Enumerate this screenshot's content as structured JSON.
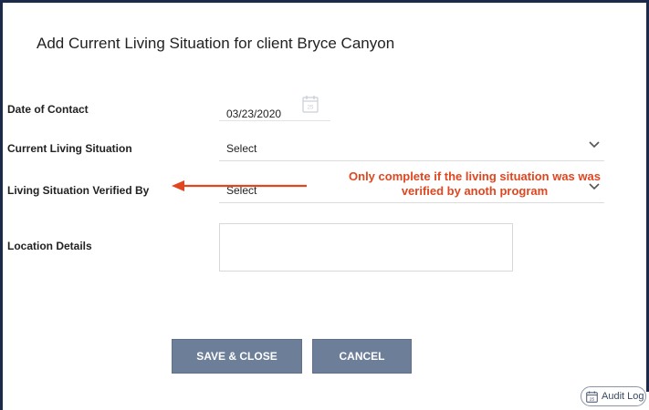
{
  "dialog": {
    "title": "Add Current Living Situation for client Bryce Canyon"
  },
  "form": {
    "date_of_contact": {
      "label": "Date of Contact",
      "value": "03/23/2020",
      "calendar_day": "25"
    },
    "current_living_situation": {
      "label": "Current Living Situation",
      "value": "Select"
    },
    "verified_by": {
      "label": "Living Situation Verified By",
      "value": "Select"
    },
    "location_details": {
      "label": "Location Details",
      "value": ""
    }
  },
  "annotation": {
    "line1": "Only complete if the living situation was was",
    "line2": "verified by anoth program",
    "color": "#e0461f"
  },
  "buttons": {
    "save_close": "SAVE & CLOSE",
    "cancel": "CANCEL",
    "color": "#6c7e98"
  },
  "audit_log": {
    "label": "Audit Log",
    "icon_day": "25"
  }
}
